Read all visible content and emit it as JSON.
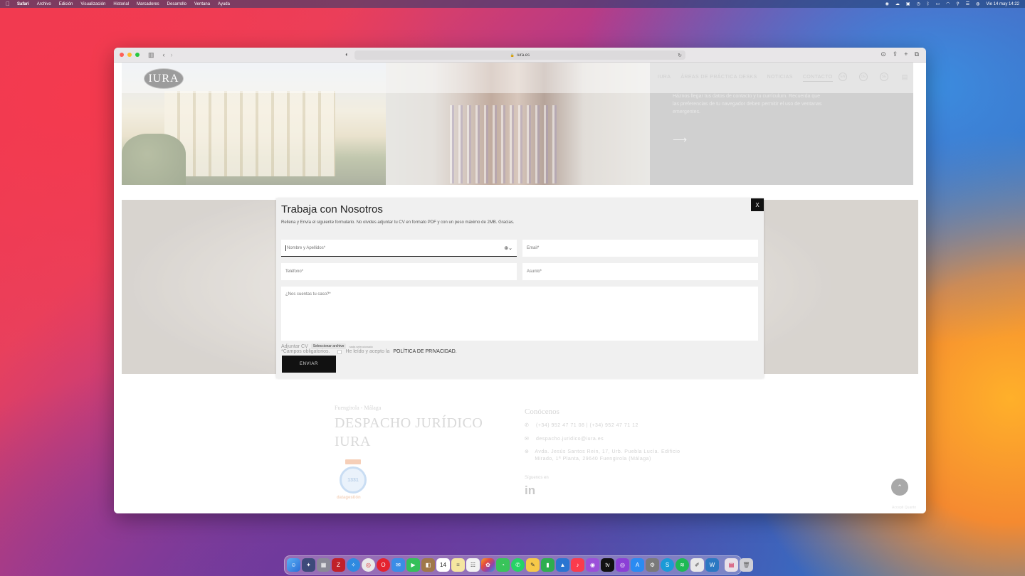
{
  "menubar": {
    "app": "Safari",
    "items": [
      "Archivo",
      "Edición",
      "Visualización",
      "Historial",
      "Marcadores",
      "Desarrollo",
      "Ventana",
      "Ayuda"
    ],
    "clock": "Vie 14 may  14:22"
  },
  "browser": {
    "url": "iura.es"
  },
  "site": {
    "logo": "IURA",
    "nav": [
      "IURA",
      "ÁREAS DE PRÁCTICA DESKS",
      "NOTICIAS",
      "CONTACTO"
    ],
    "nav_active": "CONTACTO",
    "languages": [
      "EN",
      "DE",
      "SE"
    ],
    "hero_text": "Háznos llegar tus datos de contacto y tu currículum. Recuerda que las preferencias de tu navegador deben permitir el uso de ventanas emergentes.",
    "hero_arrow": "⟶"
  },
  "modal": {
    "close": "X",
    "title": "Trabaja con Nosotros",
    "subtitle": "Rellena y Envía el siguiente formulario. No olvides adjuntar tu CV en formato PDF y con un peso máximo de 2MB. Gracias.",
    "name_placeholder": "Nombre y Apellidos*",
    "email_placeholder": "Email*",
    "phone_placeholder": "Teléfono*",
    "subject_placeholder": "Asunto*",
    "message_placeholder": "¿Nos cuentas tu caso?*",
    "cv_label": "Adjuntar CV",
    "cv_button": "Seleccionar archivo",
    "cv_none": "nada seleccionado",
    "required_note": "*Campos obligatorios.",
    "privacy_text": "He leído y acepto la",
    "privacy_link": "POLÍTICA DE PRIVACIDAD.",
    "send": "ENVIAR"
  },
  "footer": {
    "city": "Fuengirola - Málaga",
    "title": "DESPACHO JURÍDICO IURA",
    "badge_number": "1331",
    "badge_label": "datagestión",
    "contact_title": "Conócenos",
    "phone": "(+34) 952 47 71 08 | (+34) 952 47 71 12",
    "email": "despacho.juridico@iura.es",
    "address": "Avda. Jesús Santos Rein, 17, Urb. Puebla Lucía. Edificio Mirado, 1ª Planta, 29640 Fuengirola (Málaga)",
    "follow": "Síguenos en",
    "linkedin": "in",
    "small": "Accepti Quanto"
  },
  "dock": {
    "calendar_day": "14"
  }
}
